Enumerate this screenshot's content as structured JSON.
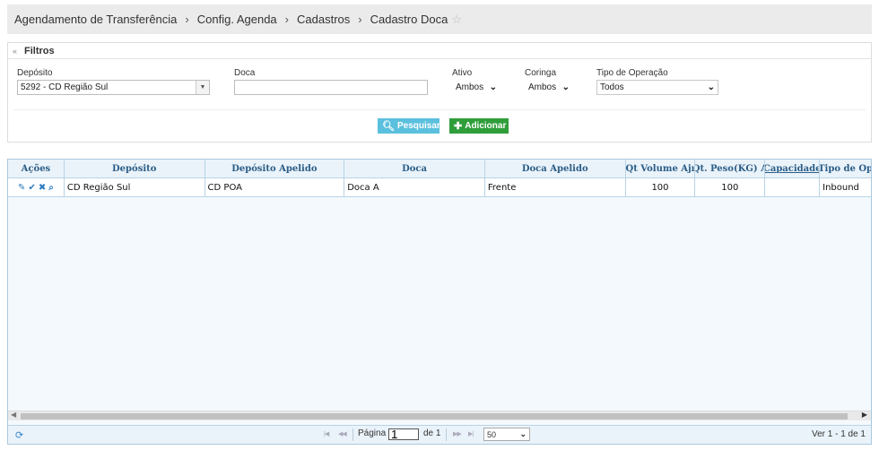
{
  "breadcrumb": {
    "items": [
      "Agendamento de Transferência",
      "Config. Agenda",
      "Cadastros",
      "Cadastro Doca"
    ],
    "separator": "›",
    "star": "☆"
  },
  "filters": {
    "title": "Filtros",
    "collapse_icon": "«",
    "deposito": {
      "label": "Depósito",
      "value": "5292 - CD Região Sul"
    },
    "doca": {
      "label": "Doca",
      "value": ""
    },
    "ativo": {
      "label": "Ativo",
      "value": "Ambos"
    },
    "coringa": {
      "label": "Coringa",
      "value": "Ambos"
    },
    "tipo_operacao": {
      "label": "Tipo de Operação",
      "value": "Todos"
    },
    "search_label": "Pesquisar",
    "add_label": "Adicionar"
  },
  "grid": {
    "columns": [
      "Ações",
      "Depósito",
      "Depósito Apelido",
      "Doca",
      "Doca Apelido",
      "Qt Volume Ajı",
      "Qt. Peso(KG) A",
      "Capacidade",
      "Tipo de Op"
    ],
    "rows": [
      {
        "deposito": "CD Região Sul",
        "deposito_apelido": "CD POA",
        "doca": "Doca A",
        "doca_apelido": "Frente",
        "qt_volume": "100",
        "qt_peso": "100",
        "capacidade": "",
        "tipo_operacao": "Inbound"
      }
    ]
  },
  "pager": {
    "page_label": "Página",
    "page_value": "1",
    "of_label": "de 1",
    "rows_per_page": "50",
    "view_text": "Ver 1 - 1 de 1"
  },
  "colors": {
    "search_button": "#5bc0de",
    "add_button": "#2f9e3a",
    "grid_header_text": "#2b5d86",
    "grid_border": "#b9d3e6"
  }
}
